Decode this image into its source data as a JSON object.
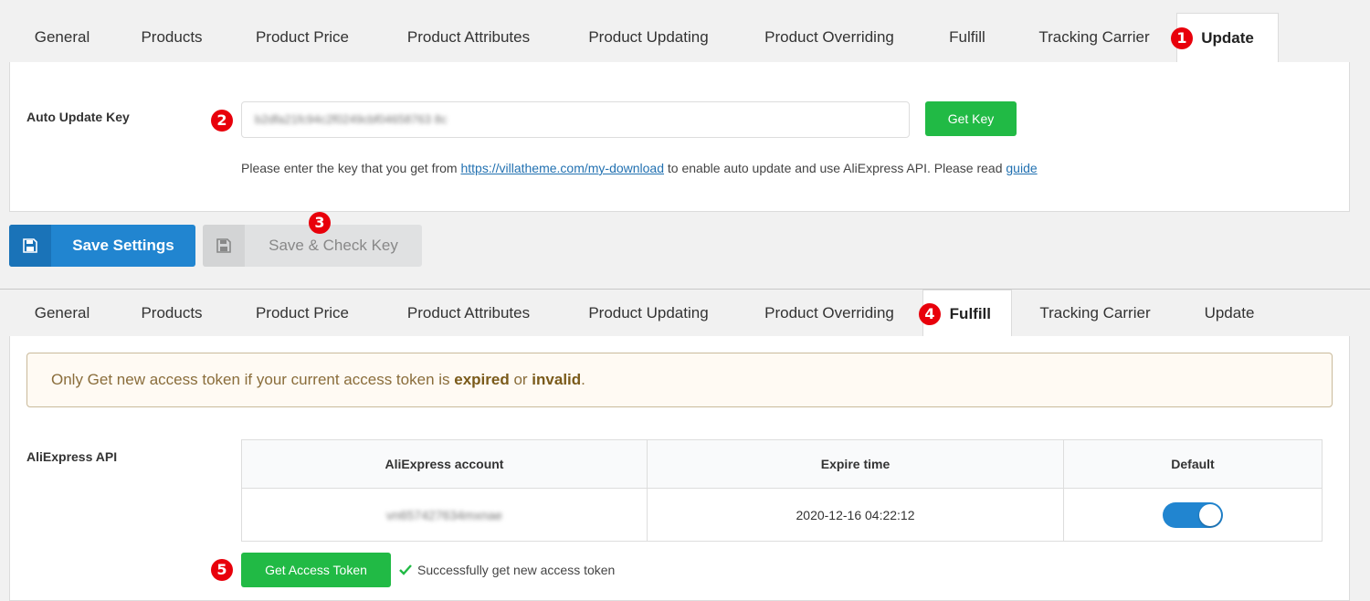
{
  "tabs": [
    "General",
    "Products",
    "Product Price",
    "Product Attributes",
    "Product Updating",
    "Product Overriding",
    "Fulfill",
    "Tracking Carrier",
    "Update"
  ],
  "markers": [
    "1",
    "2",
    "3",
    "4",
    "5"
  ],
  "update_panel": {
    "active_tab": "Update",
    "auto_update_label": "Auto Update Key",
    "key_value": "b2dfa21fc94c2f0249cbf04658763 8c",
    "get_key_label": "Get Key",
    "help_before": "Please enter the key that you get from ",
    "help_link": "https://villatheme.com/my-download",
    "help_after": " to enable auto update and use AliExpress API. Please read ",
    "guide_link": "guide",
    "save_settings_label": "Save Settings",
    "save_check_label": "Save & Check Key"
  },
  "fulfill_panel": {
    "active_tab": "Fulfill",
    "notice_before": "Only Get new access token if your current access token is ",
    "notice_expired": "expired",
    "notice_or": " or ",
    "notice_invalid": "invalid",
    "notice_end": ".",
    "api_label": "AliExpress API",
    "table": {
      "headers": [
        "AliExpress account",
        "Expire time",
        "Default"
      ],
      "rows": [
        {
          "account": "vn657427634mxnae",
          "expire": "2020-12-16 04:22:12",
          "default": true
        }
      ]
    },
    "get_token_label": "Get Access Token",
    "success_text": "Successfully get new access token"
  },
  "colors": {
    "accent_blue": "#2185d0",
    "green": "#21ba45",
    "marker_red": "#e8000b"
  }
}
